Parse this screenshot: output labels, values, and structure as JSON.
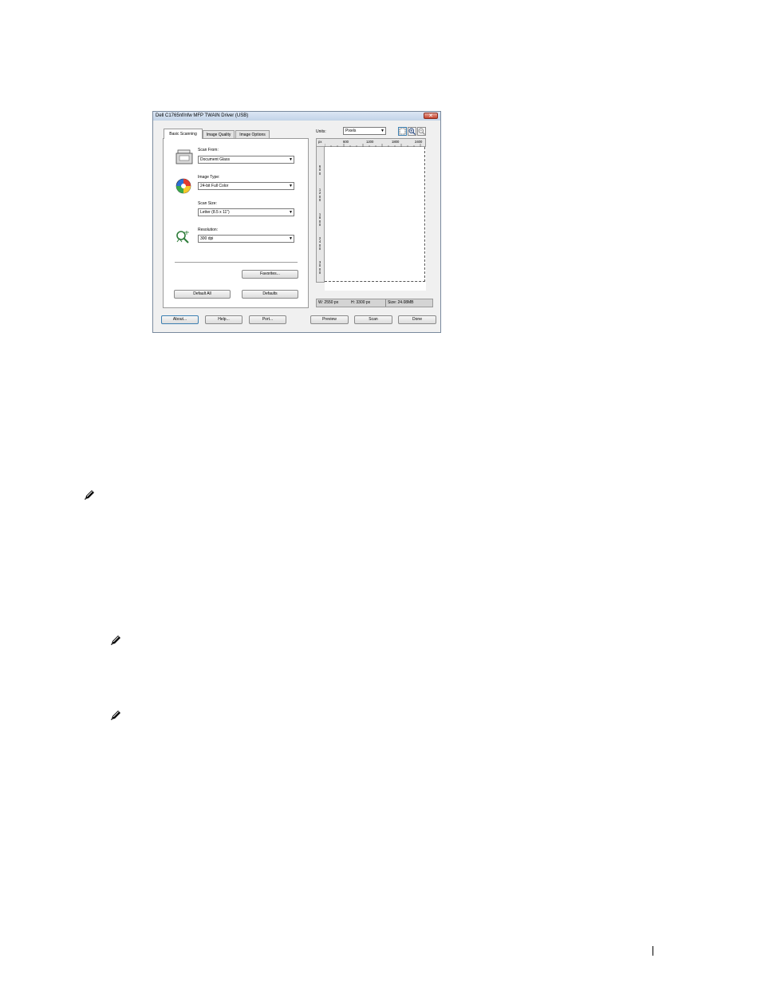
{
  "window": {
    "title": "Dell C1765nf/nfw MFP TWAIN Driver (USB)",
    "close_glyph": "✕"
  },
  "tabs": [
    {
      "label": "Basic Scanning",
      "active": true
    },
    {
      "label": "Image Quality",
      "active": false
    },
    {
      "label": "Image Options",
      "active": false
    }
  ],
  "fields": {
    "scan_from": {
      "label": "Scan From:",
      "value": "Document Glass",
      "icon": "scanner-glass-icon"
    },
    "image_type": {
      "label": "Image Type:",
      "value": "24-bit Full Color",
      "icon": "color-wheel-icon"
    },
    "scan_size": {
      "label": "Scan Size:",
      "value": "Letter (8.5 x 11\")"
    },
    "resolution": {
      "label": "Resolution:",
      "value": "300 dpi",
      "icon": "resolution-magnifier-icon"
    }
  },
  "panel_buttons": {
    "favorites": "Favorites...",
    "default_all": "Default All",
    "defaults": "Defaults"
  },
  "preview": {
    "units_label": "Units:",
    "units_value": "Pixels",
    "ruler_unit": "px",
    "ruler_top_ticks": [
      "600",
      "1200",
      "1800",
      "2400"
    ],
    "ruler_left_ticks": [
      "600",
      "1200",
      "1800",
      "2400",
      "3000"
    ],
    "tools": [
      "select-area-icon",
      "zoom-in-icon",
      "zoom-out-icon"
    ]
  },
  "status": {
    "width": "W: 2550 px",
    "height": "H: 3300 px",
    "size": "Size: 24.08MB"
  },
  "bottom_buttons": {
    "about": "About...",
    "help": "Help...",
    "port": "Port...",
    "preview": "Preview",
    "scan": "Scan",
    "done": "Done"
  },
  "colors": {
    "accent_border": "#3c7fb1",
    "close_button": "#c5442e"
  }
}
